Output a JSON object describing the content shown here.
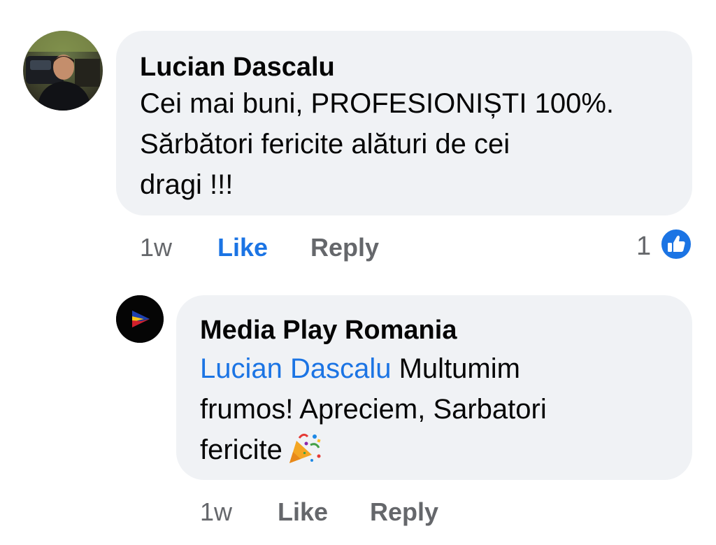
{
  "comment": {
    "author": "Lucian Dascalu",
    "text": "Cei mai buni, PROFESIONIȘTI 100%.\nSărbători fericite alături de cei\ndragi !!!",
    "time": "1w",
    "like_label": "Like",
    "reply_label": "Reply",
    "reaction_count": "1",
    "reaction_icon": "like-reaction-icon"
  },
  "reply": {
    "author": "Media Play Romania",
    "mention": "Lucian Dascalu",
    "text_before_emoji": " Multumim\nfrumos! Apreciem, Sarbatori\nfericite",
    "emoji": "party-popper-icon",
    "time": "1w",
    "like_label": "Like",
    "reply_label": "Reply"
  },
  "colors": {
    "bubble": "#f0f2f5",
    "link": "#1b74e4",
    "meta": "#65676b"
  }
}
